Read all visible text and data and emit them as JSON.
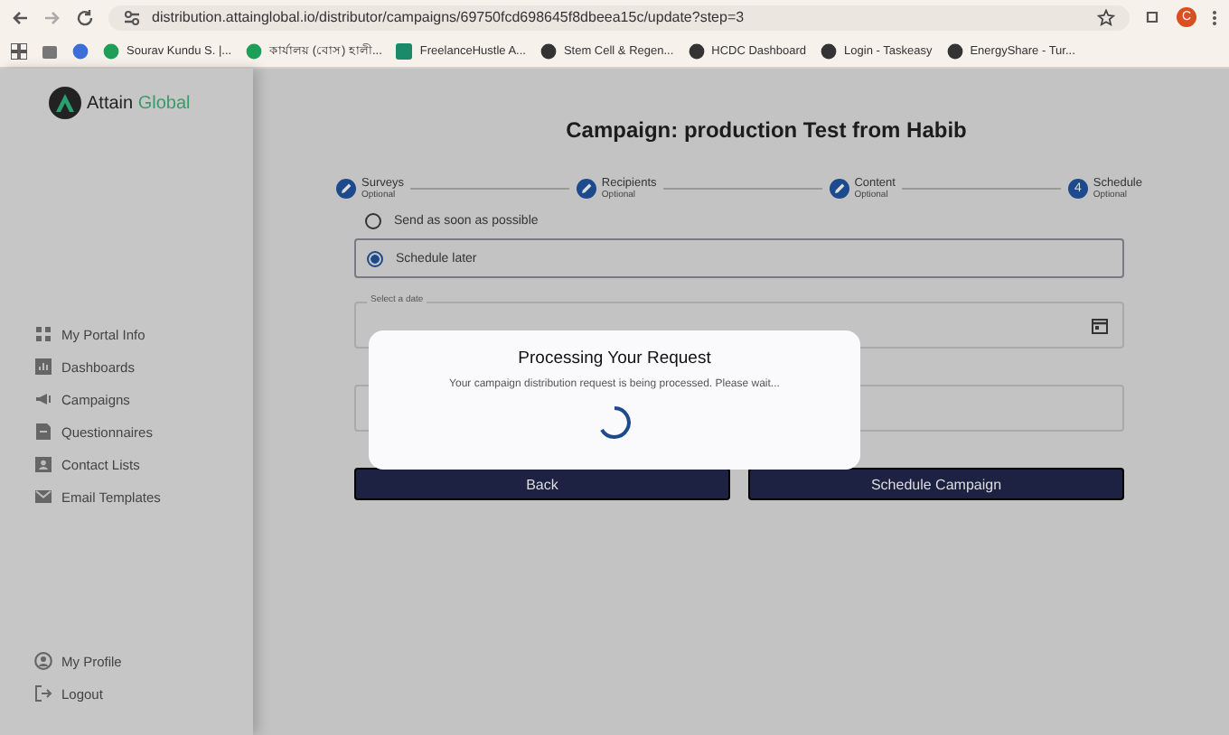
{
  "browser": {
    "url": "distribution.attainglobal.io/distributor/campaigns/69750fcd698645f8dbeea15c/update?step=3",
    "profile_initial": "C",
    "bookmarks": [
      {
        "label": "Sourav Kundu S. |..."
      },
      {
        "label": "কার্যালয় (বোস) হালী..."
      },
      {
        "label": "FreelanceHustle A..."
      },
      {
        "label": "Stem Cell & Regen..."
      },
      {
        "label": "HCDC Dashboard"
      },
      {
        "label": "Login - Taskeasy"
      },
      {
        "label": "EnergyShare - Tur..."
      }
    ]
  },
  "sidebar": {
    "logo": {
      "word1": "Attain",
      "word2": "Global"
    },
    "items": [
      {
        "label": "My Portal Info"
      },
      {
        "label": "Dashboards"
      },
      {
        "label": "Campaigns"
      },
      {
        "label": "Questionnaires"
      },
      {
        "label": "Contact Lists"
      },
      {
        "label": "Email Templates"
      }
    ],
    "footer_items": [
      {
        "label": "My Profile"
      },
      {
        "label": "Logout"
      }
    ]
  },
  "main": {
    "title": "Campaign: production Test from Habib",
    "steps": [
      {
        "label": "Surveys",
        "sublabel": "Optional",
        "completed": true
      },
      {
        "label": "Recipients",
        "sublabel": "Optional",
        "completed": true
      },
      {
        "label": "Content",
        "sublabel": "Optional",
        "completed": true
      },
      {
        "label": "Schedule",
        "sublabel": "Optional",
        "completed": false,
        "number": "4"
      }
    ],
    "options": [
      {
        "label": "Send as soon as possible",
        "selected": false
      },
      {
        "label": "Schedule later",
        "selected": true
      }
    ],
    "date_field": {
      "label": "Select a date"
    },
    "buttons": [
      "Back",
      "Schedule Campaign"
    ]
  },
  "dialog": {
    "title": "Processing Your Request",
    "message": "Your campaign distribution request is being processed. Please wait..."
  }
}
